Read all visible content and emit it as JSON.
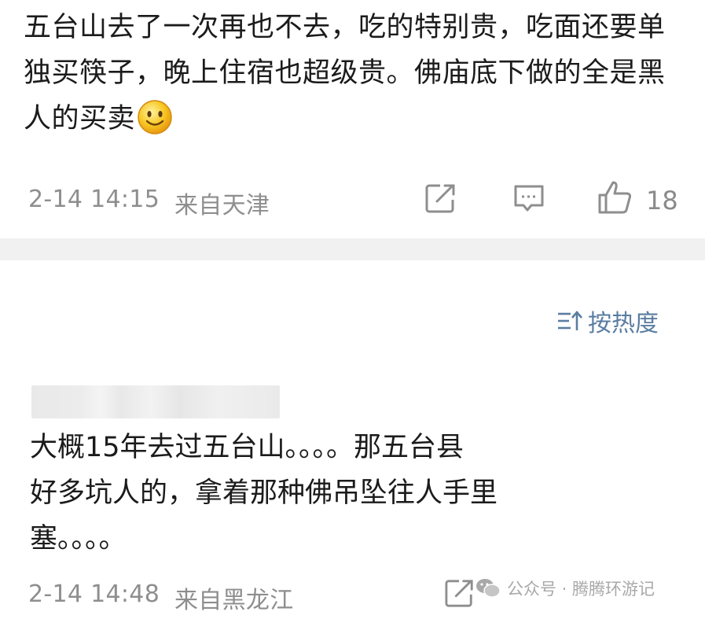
{
  "comment_top": {
    "text": "五台山去了一次再也不去，吃的特别贵，吃面还要单独买筷子，晚上住宿也超级贵。佛庙底下做的全是黑人的买卖",
    "emoji": "smile-emoji",
    "timestamp": "2-14 14:15",
    "location": "来自天津",
    "like_count": "18"
  },
  "sort": {
    "label": "按热度",
    "icon": "sort-icon"
  },
  "comment_reply": {
    "text": "大概15年去过五台山。。。。那五台县\n好多坑人的，拿着那种佛吊坠往人手里\n塞。。。。",
    "timestamp": "2-14 14:48",
    "location": "来自黑龙江"
  },
  "watermark": {
    "text": "公众号 · 腾腾环游记",
    "icon": "wechat-icon"
  },
  "colors": {
    "meta_gray": "#8e8e8e",
    "sort_blue": "#5a7da2",
    "divider": "#f1f1f1"
  }
}
